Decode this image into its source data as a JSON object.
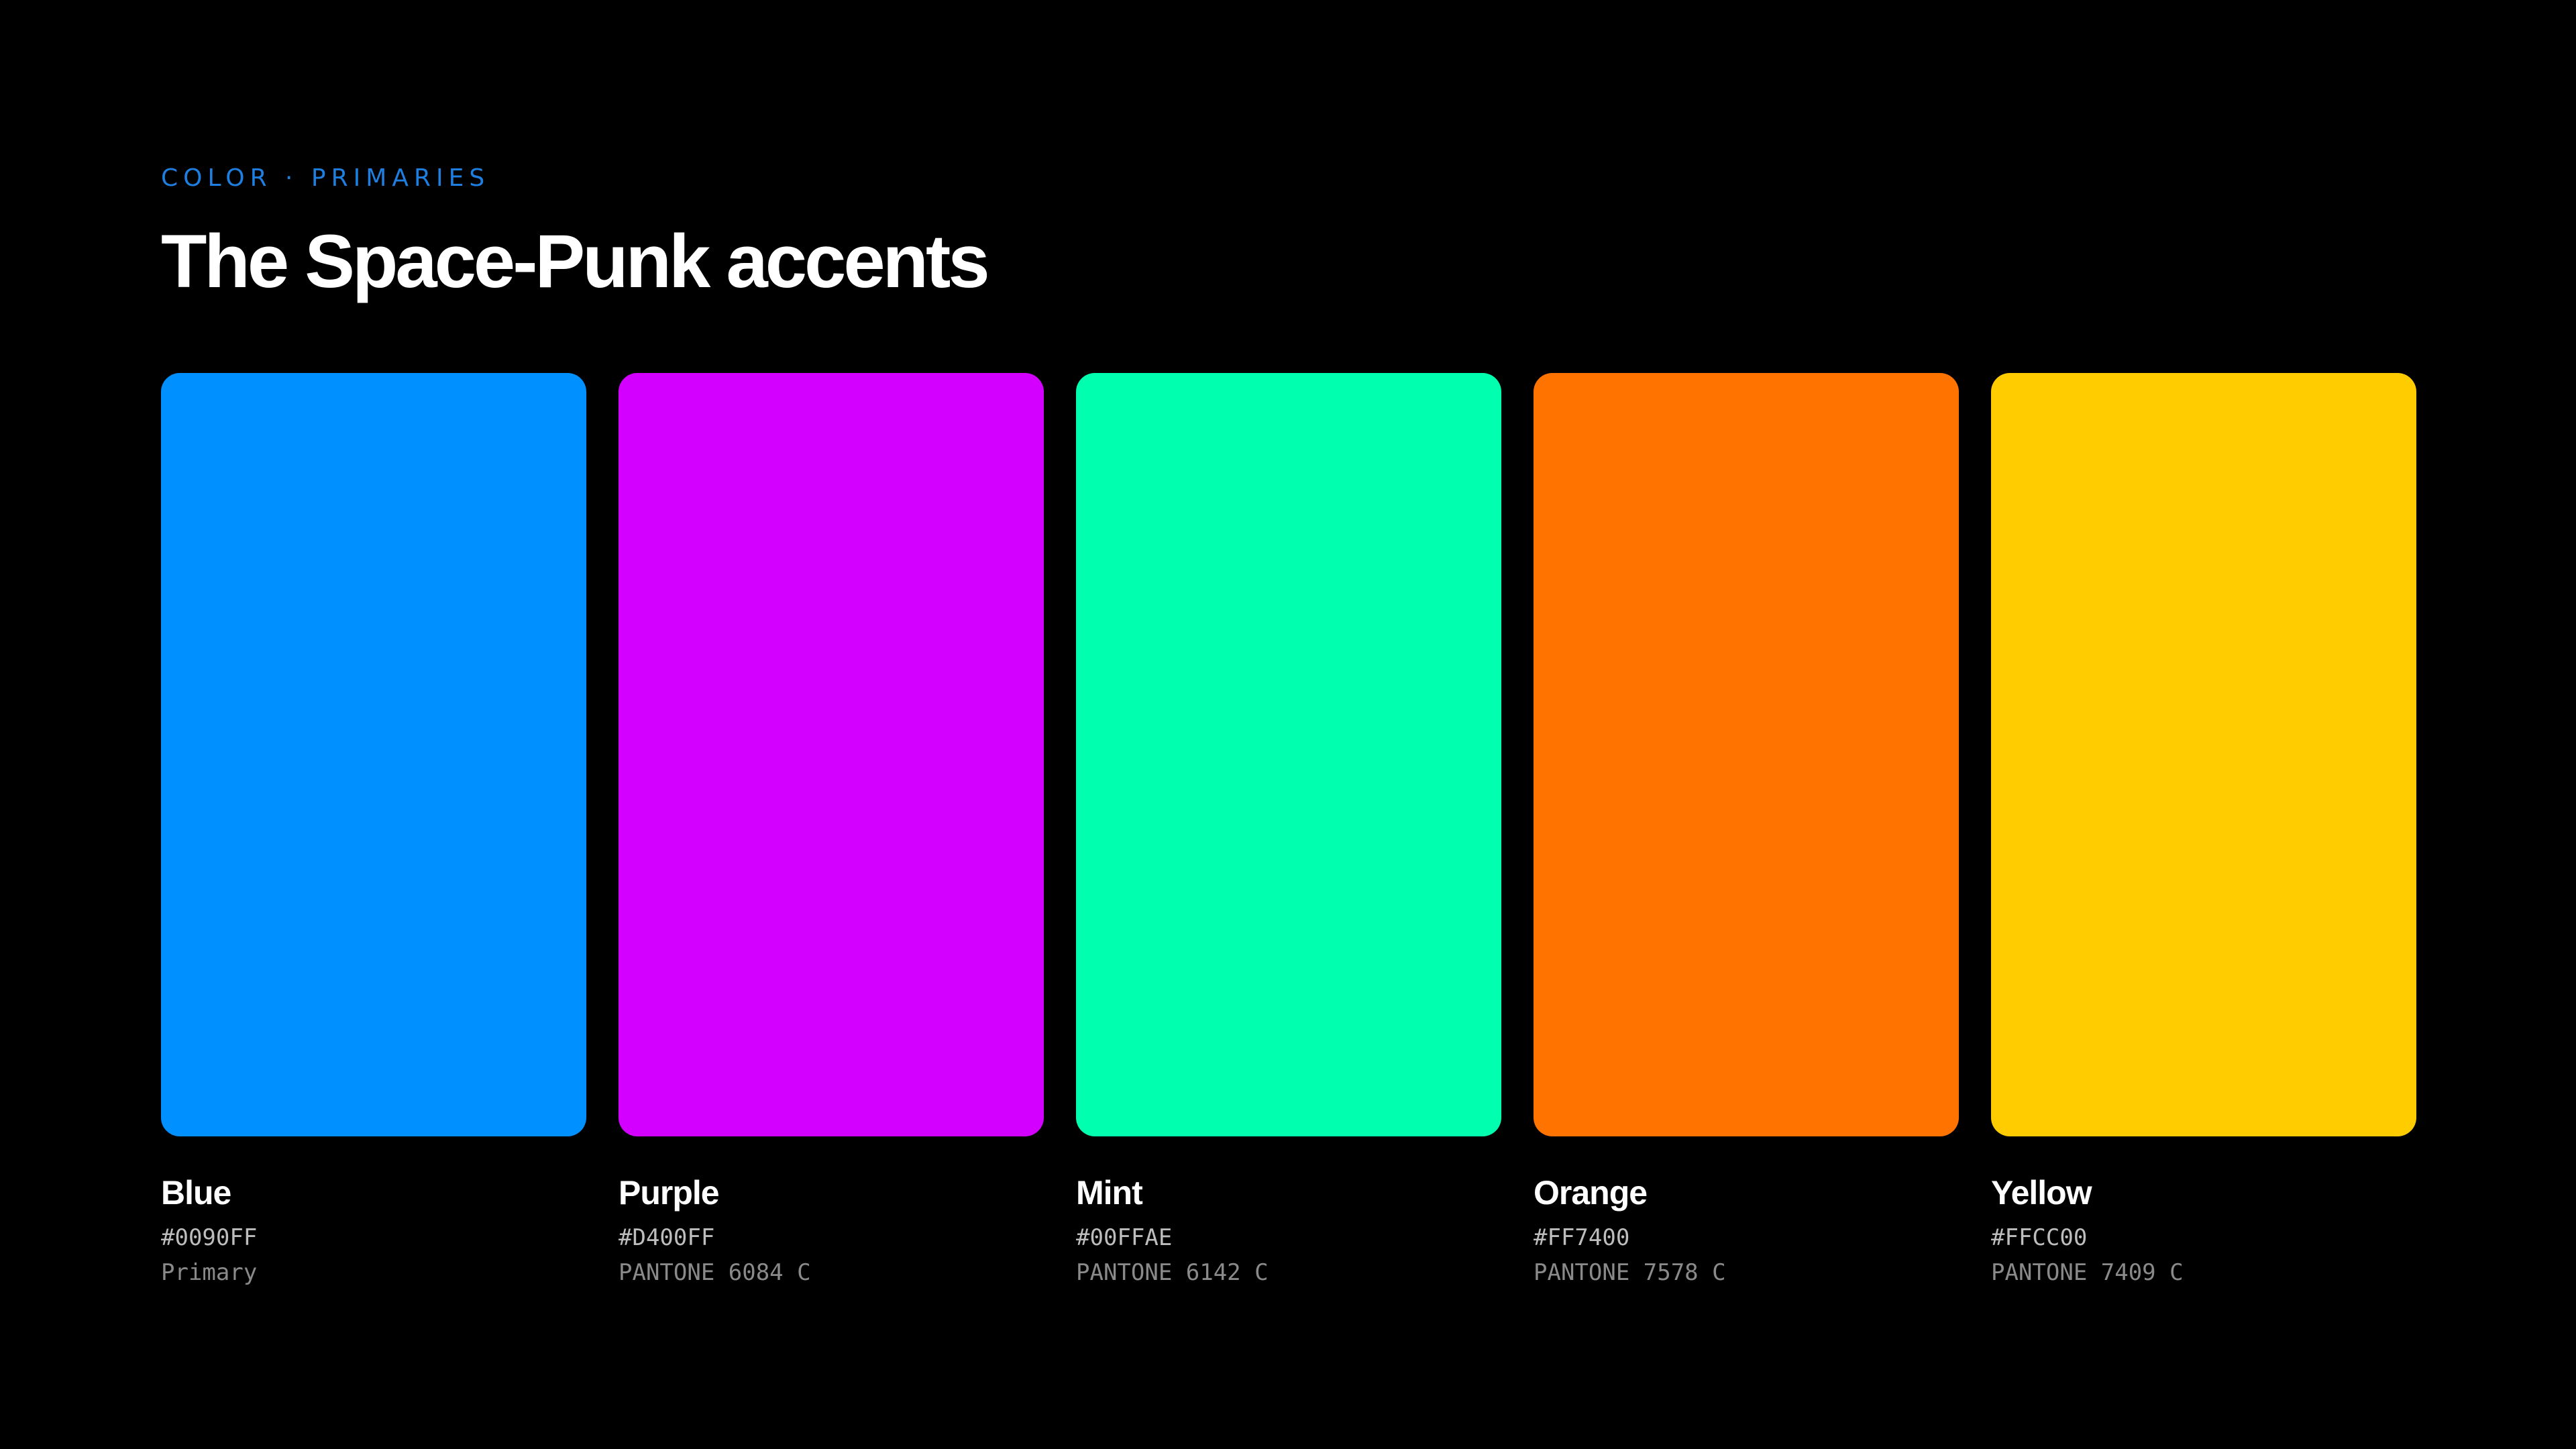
{
  "header": {
    "eyebrow": "COLOR · PRIMARIES",
    "title": "The Space-Punk accents"
  },
  "theme": {
    "background": "#000000",
    "eyebrow_color": "#1E7FE0",
    "title_color": "#FFFFFF",
    "hex_text_color": "#BDBDBD",
    "meta_text_color": "#8A8A8A"
  },
  "swatches": [
    {
      "name": "Blue",
      "hex": "#0090FF",
      "meta": "Primary",
      "color": "#0090FF"
    },
    {
      "name": "Purple",
      "hex": "#D400FF",
      "meta": "PANTONE 6084 C",
      "color": "#D400FF"
    },
    {
      "name": "Mint",
      "hex": "#00FFAE",
      "meta": "PANTONE 6142 C",
      "color": "#00FFAE"
    },
    {
      "name": "Orange",
      "hex": "#FF7400",
      "meta": "PANTONE 7578 C",
      "color": "#FF7400"
    },
    {
      "name": "Yellow",
      "hex": "#FFCC00",
      "meta": "PANTONE 7409 C",
      "color": "#FFCC00"
    }
  ]
}
